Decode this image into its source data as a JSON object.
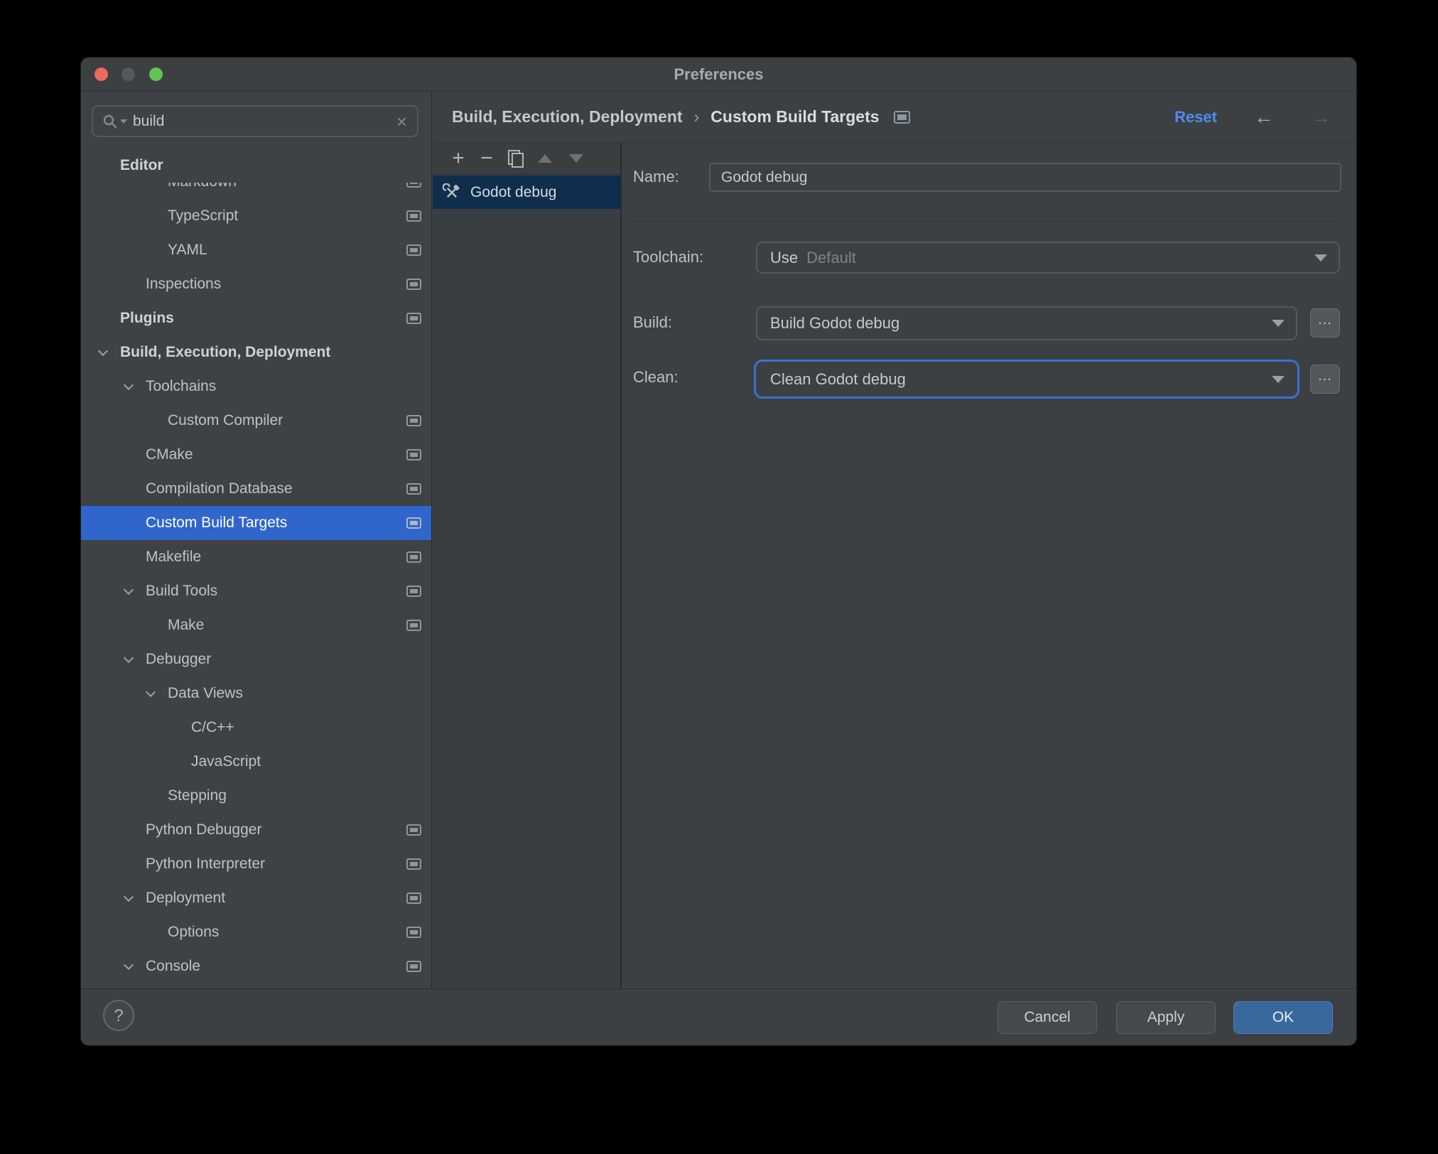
{
  "window": {
    "title": "Preferences",
    "traffic_lights": [
      {
        "name": "close",
        "color": "#EC6A5E"
      },
      {
        "name": "minimize",
        "color": "#55595C"
      },
      {
        "name": "zoom",
        "color": "#61C454"
      }
    ]
  },
  "search": {
    "value": "build",
    "clear_icon": "×"
  },
  "sidebar": {
    "items": [
      {
        "label": "Editor",
        "level": 0,
        "bold": true,
        "header": true,
        "chevron": false,
        "found": false,
        "selected": false
      },
      {
        "label": "Markdown",
        "level": 2,
        "bold": false,
        "chevron": false,
        "found": true,
        "selected": false
      },
      {
        "label": "TypeScript",
        "level": 2,
        "bold": false,
        "chevron": false,
        "found": true,
        "selected": false
      },
      {
        "label": "YAML",
        "level": 2,
        "bold": false,
        "chevron": false,
        "found": true,
        "selected": false
      },
      {
        "label": "Inspections",
        "level": 1,
        "bold": false,
        "chevron": false,
        "found": true,
        "selected": false
      },
      {
        "label": "Plugins",
        "level": 0,
        "bold": true,
        "chevron": false,
        "found": true,
        "selected": false
      },
      {
        "label": "Build, Execution, Deployment",
        "level": 0,
        "bold": true,
        "chevron": true,
        "found": false,
        "selected": false
      },
      {
        "label": "Toolchains",
        "level": 1,
        "bold": false,
        "chevron": true,
        "found": false,
        "selected": false
      },
      {
        "label": "Custom Compiler",
        "level": 2,
        "bold": false,
        "chevron": false,
        "found": true,
        "selected": false
      },
      {
        "label": "CMake",
        "level": 1,
        "bold": false,
        "chevron": false,
        "found": true,
        "selected": false
      },
      {
        "label": "Compilation Database",
        "level": 1,
        "bold": false,
        "chevron": false,
        "found": true,
        "selected": false
      },
      {
        "label": "Custom Build Targets",
        "level": 1,
        "bold": false,
        "chevron": false,
        "found": true,
        "selected": true
      },
      {
        "label": "Makefile",
        "level": 1,
        "bold": false,
        "chevron": false,
        "found": true,
        "selected": false
      },
      {
        "label": "Build Tools",
        "level": 1,
        "bold": false,
        "chevron": true,
        "found": true,
        "selected": false
      },
      {
        "label": "Make",
        "level": 2,
        "bold": false,
        "chevron": false,
        "found": true,
        "selected": false
      },
      {
        "label": "Debugger",
        "level": 1,
        "bold": false,
        "chevron": true,
        "found": false,
        "selected": false
      },
      {
        "label": "Data Views",
        "level": 2,
        "bold": false,
        "chevron": true,
        "found": false,
        "selected": false
      },
      {
        "label": "C/C++",
        "level": 3,
        "bold": false,
        "chevron": false,
        "found": false,
        "selected": false
      },
      {
        "label": "JavaScript",
        "level": 3,
        "bold": false,
        "chevron": false,
        "found": false,
        "selected": false
      },
      {
        "label": "Stepping",
        "level": 2,
        "bold": false,
        "chevron": false,
        "found": false,
        "selected": false
      },
      {
        "label": "Python Debugger",
        "level": 1,
        "bold": false,
        "chevron": false,
        "found": true,
        "selected": false
      },
      {
        "label": "Python Interpreter",
        "level": 1,
        "bold": false,
        "chevron": false,
        "found": true,
        "selected": false
      },
      {
        "label": "Deployment",
        "level": 1,
        "bold": false,
        "chevron": true,
        "found": true,
        "selected": false
      },
      {
        "label": "Options",
        "level": 2,
        "bold": false,
        "chevron": false,
        "found": true,
        "selected": false
      },
      {
        "label": "Console",
        "level": 1,
        "bold": false,
        "chevron": true,
        "found": true,
        "selected": false
      }
    ]
  },
  "breadcrumb": {
    "parts": [
      "Build, Execution, Deployment",
      "Custom Build Targets"
    ],
    "separator": "›"
  },
  "header": {
    "reset_label": "Reset",
    "back_icon": "←",
    "forward_icon": "→"
  },
  "list": {
    "toolbar": [
      {
        "name": "add",
        "glyph": "+",
        "enabled": true
      },
      {
        "name": "remove",
        "glyph": "−",
        "enabled": true
      },
      {
        "name": "duplicate",
        "glyph": "",
        "enabled": true
      },
      {
        "name": "move-up",
        "glyph": "",
        "enabled": false
      },
      {
        "name": "move-down",
        "glyph": "",
        "enabled": false
      }
    ],
    "items": [
      {
        "label": "Godot debug",
        "icon": "build-target-tools-icon",
        "selected": true
      }
    ]
  },
  "form": {
    "name_label": "Name:",
    "name_value": "Godot debug",
    "toolchain_label": "Toolchain:",
    "toolchain_prefix": "Use",
    "toolchain_value": "Default",
    "build_label": "Build:",
    "build_value": "Build Godot debug",
    "clean_label": "Clean:",
    "clean_value": "Clean Godot debug",
    "browse_label": "..."
  },
  "footer": {
    "help_label": "?",
    "cancel_label": "Cancel",
    "apply_label": "Apply",
    "ok_label": "OK"
  },
  "colors": {
    "tree_selection": "#3065CB",
    "list_selection": "#0F2D4D",
    "link": "#4E8CEC",
    "ok_button": "#38689C",
    "focus_ring": "#3A72D0"
  }
}
